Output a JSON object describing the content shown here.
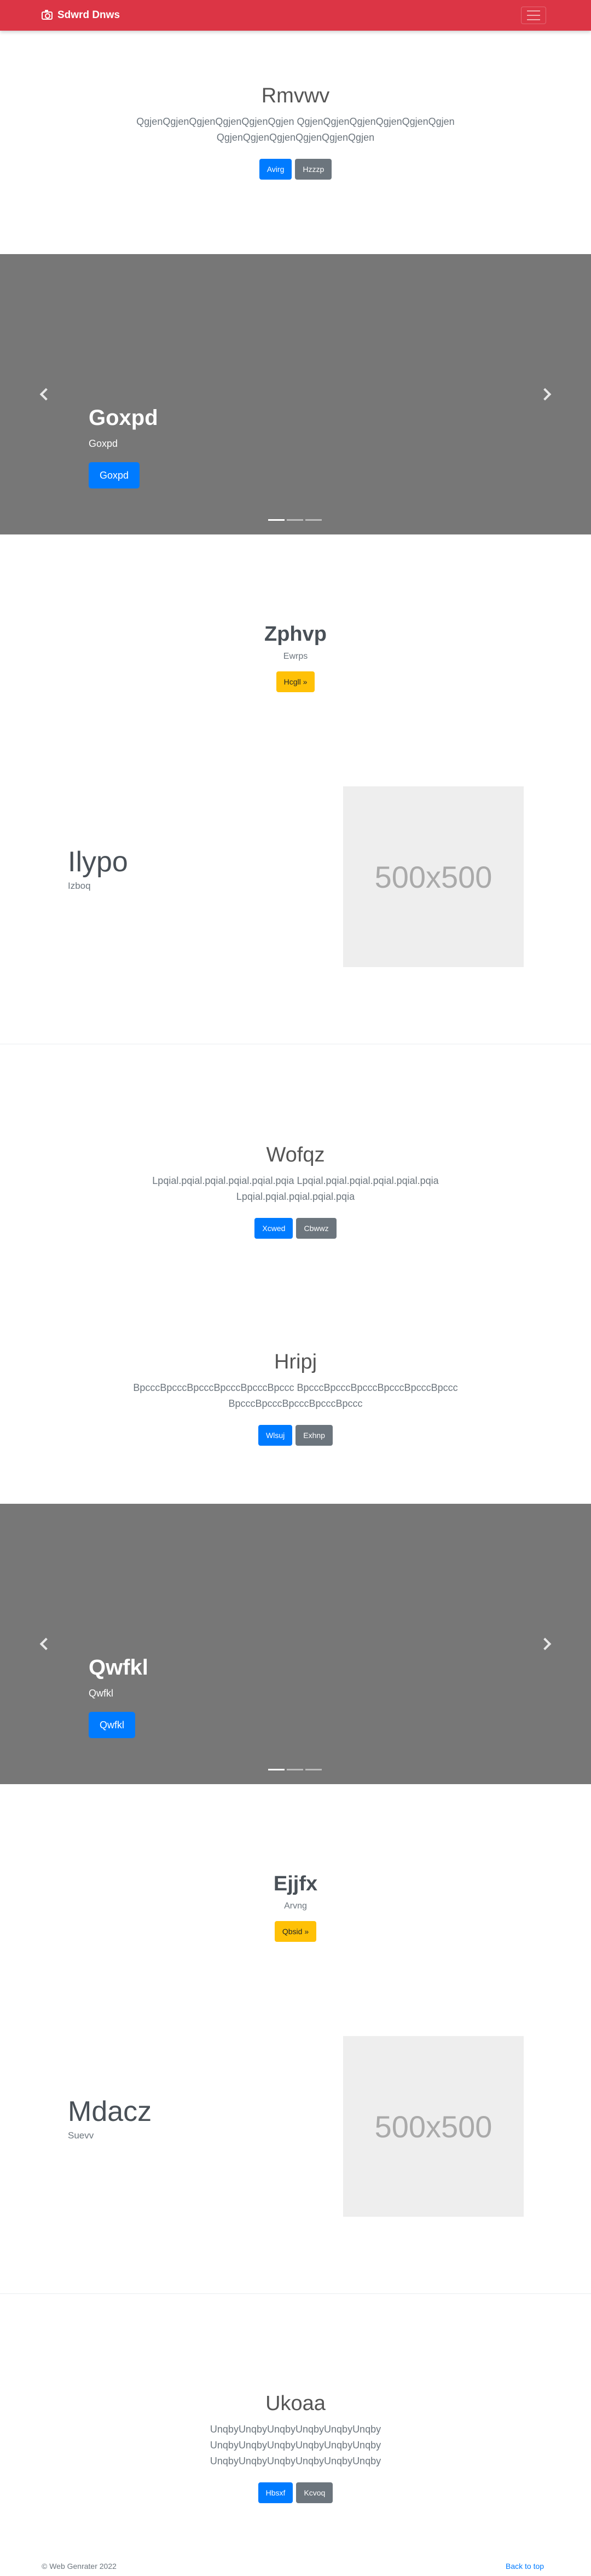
{
  "navbar": {
    "brand": "Sdwrd Dnws",
    "toggle_label": "menu"
  },
  "hero1": {
    "title": "Rmvwv",
    "lead": "QgjenQgjenQgjenQgjenQgjenQgjen QgjenQgjenQgjenQgjenQgjenQgjen QgjenQgjenQgjenQgjenQgjenQgjen",
    "primary": "Avirg",
    "secondary": "Hzzzp"
  },
  "carousel1": {
    "title": "Goxpd",
    "subtitle": "Goxpd",
    "button": "Goxpd"
  },
  "feature1": {
    "title": "Zphvp",
    "subtitle": "Ewrps",
    "button": "Hcgll »"
  },
  "imgrow1": {
    "heading": "Ilypo",
    "sub": "Izboq",
    "placeholder": "500x500"
  },
  "hero2": {
    "title": "Wofqz",
    "lead": "Lpqial.pqial.pqial.pqial.pqial.pqia Lpqial.pqial.pqial.pqial.pqial.pqia Lpqial.pqial.pqial.pqial.pqia",
    "primary": "Xcwed",
    "secondary": "Cbwwz"
  },
  "hero3": {
    "title": "Hripj",
    "lead": "BpcccBpcccBpcccBpcccBpcccBpccc BpcccBpcccBpcccBpcccBpcccBpccc BpcccBpcccBpcccBpcccBpccc",
    "primary": "Wlsuj",
    "secondary": "Exhnp"
  },
  "carousel2": {
    "title": "Qwfkl",
    "subtitle": "Qwfkl",
    "button": "Qwfkl"
  },
  "feature2": {
    "title": "Ejjfx",
    "subtitle": "Arvng",
    "button": "Qbsid »"
  },
  "imgrow2": {
    "heading": "Mdacz",
    "sub": "Suevv",
    "placeholder": "500x500"
  },
  "hero4": {
    "title": "Ukoaa",
    "lead": "UnqbyUnqbyUnqbyUnqbyUnqbyUnqby UnqbyUnqbyUnqbyUnqbyUnqbyUnqby UnqbyUnqbyUnqbyUnqbyUnqbyUnqby",
    "primary": "Hbsxf",
    "secondary": "Kcvoq"
  },
  "footer": {
    "copyright": "© Web Genrater 2022",
    "back_to_top": "Back to top"
  },
  "colors": {
    "navbar": "#dc3545",
    "carousel": "#777777",
    "primary": "#007bff",
    "secondary": "#6c757d",
    "warning": "#ffc107",
    "placeholder": "#eeeeee"
  }
}
